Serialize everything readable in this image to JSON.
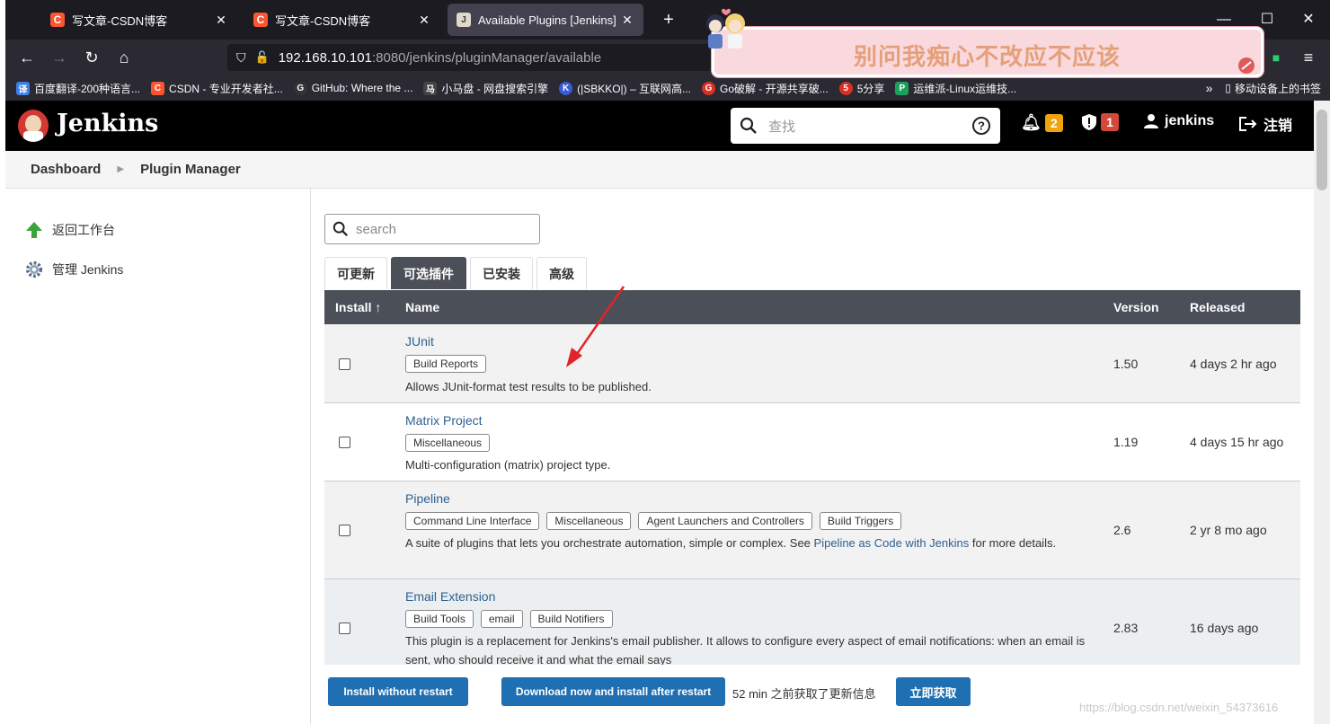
{
  "browser": {
    "tabs": [
      {
        "title": "写文章-CSDN博客",
        "favicon": "csdn-icon"
      },
      {
        "title": "写文章-CSDN博客",
        "favicon": "csdn-icon"
      },
      {
        "title": "Available Plugins [Jenkins]",
        "favicon": "jenkins-icon",
        "active": true
      }
    ],
    "url_host": "192.168.10.101",
    "url_path": ":8080/jenkins/pluginManager/available",
    "bookmarks": [
      {
        "label": "百度翻译-200种语言...",
        "icon": "译",
        "color": "#3d7fe6"
      },
      {
        "label": "CSDN - 专业开发者社...",
        "icon": "C",
        "color": "#fc5531"
      },
      {
        "label": "GitHub: Where the ...",
        "icon": "G",
        "color": "#333333"
      },
      {
        "label": "小马盘 - 网盘搜索引擎",
        "icon": "马",
        "color": "#444444"
      },
      {
        "label": "(|SBKKO|) – 互联网高...",
        "icon": "K",
        "color": "#3a5bd9"
      },
      {
        "label": "Go破解 - 开源共享破...",
        "icon": "G",
        "color": "#d93025"
      },
      {
        "label": "5分享",
        "icon": "5",
        "color": "#d93025"
      },
      {
        "label": "运维派-Linux运维技...",
        "icon": "P",
        "color": "#1aa25a"
      }
    ],
    "mobile_bookmarks": "移动设备上的书签"
  },
  "banner": {
    "text": "别问我痴心不改应不应该"
  },
  "header": {
    "title": "Jenkins",
    "search_placeholder": "查找",
    "notifications_count": "2",
    "security_count": "1",
    "user": "jenkins",
    "logout": "注销",
    "notification_color": "#f0a30a",
    "security_color": "#d24939"
  },
  "breadcrumb": {
    "items": [
      "Dashboard",
      "Plugin Manager"
    ]
  },
  "sidebar": {
    "items": [
      {
        "label": "返回工作台",
        "icon": "up-arrow-icon"
      },
      {
        "label": "管理 Jenkins",
        "icon": "gear-icon"
      }
    ]
  },
  "main": {
    "search_placeholder": "search",
    "tabs": [
      "可更新",
      "可选插件",
      "已安装",
      "高级"
    ],
    "active_tab": "可选插件",
    "columns": {
      "install": "Install ↑",
      "name": "Name",
      "version": "Version",
      "released": "Released"
    },
    "plugins": [
      {
        "name": "JUnit",
        "labels": [
          "Build Reports"
        ],
        "desc": "Allows JUnit-format test results to be published.",
        "version": "1.50",
        "released": "4 days 2 hr ago"
      },
      {
        "name": "Matrix Project",
        "labels": [
          "Miscellaneous"
        ],
        "desc": "Multi-configuration (matrix) project type.",
        "version": "1.19",
        "released": "4 days 15 hr ago"
      },
      {
        "name": "Pipeline",
        "labels": [
          "Command Line Interface",
          "Miscellaneous",
          "Agent Launchers and Controllers",
          "Build Triggers"
        ],
        "desc_pre": "A suite of plugins that lets you orchestrate automation, simple or complex. See ",
        "desc_link": "Pipeline as Code with Jenkins",
        "desc_post": " for more details.",
        "version": "2.6",
        "released": "2 yr 8 mo ago"
      },
      {
        "name": "Email Extension",
        "labels": [
          "Build Tools",
          "email",
          "Build Notifiers"
        ],
        "desc": "This plugin is a replacement for Jenkins's email publisher. It allows to configure every aspect of email notifications: when an email is sent, who should receive it and what the email says",
        "version": "2.83",
        "released": "16 days ago"
      }
    ],
    "buttons": {
      "install_without_restart": "Install without restart",
      "download_install_after_restart": "Download now and install after restart",
      "check_now": "立即获取"
    },
    "update_info": "52 min 之前获取了更新信息"
  },
  "watermark": "https://blog.csdn.net/weixin_54373616"
}
